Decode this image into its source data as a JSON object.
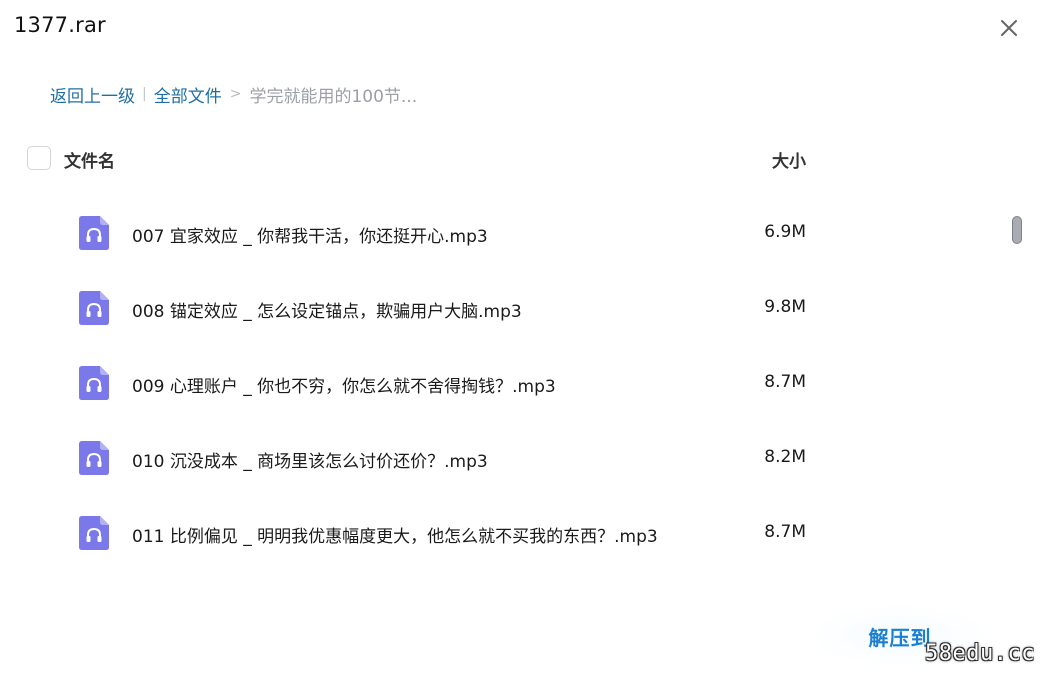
{
  "window": {
    "title": "1377.rar",
    "close_icon": "close-icon"
  },
  "breadcrumb": {
    "back_label": "返回上一级",
    "separator": "|",
    "all_files_label": "全部文件",
    "arrow": ">",
    "current": "学完就能用的100节..."
  },
  "table": {
    "header_name": "文件名",
    "header_size": "大小"
  },
  "files": [
    {
      "icon": "audio-file-icon",
      "name": "007 宜家效应 _ 你帮我干活，你还挺开心.mp3",
      "size": "6.9M"
    },
    {
      "icon": "audio-file-icon",
      "name": "008 锚定效应 _ 怎么设定锚点，欺骗用户大脑.mp3",
      "size": "9.8M"
    },
    {
      "icon": "audio-file-icon",
      "name": "009 心理账户 _ 你也不穷，你怎么就不舍得掏钱？.mp3",
      "size": "8.7M"
    },
    {
      "icon": "audio-file-icon",
      "name": "010 沉没成本 _ 商场里该怎么讨价还价？.mp3",
      "size": "8.2M"
    },
    {
      "icon": "audio-file-icon",
      "name": "011 比例偏见 _ 明明我优惠幅度更大，他怎么就不买我的东西？.mp3",
      "size": "8.7M"
    }
  ],
  "actions": {
    "extract_label": "解压到"
  },
  "watermark": "58edu.cc",
  "colors": {
    "accent": "#1a7fd1",
    "link": "#1f6fa6",
    "icon_purple": "#7b78ea"
  }
}
